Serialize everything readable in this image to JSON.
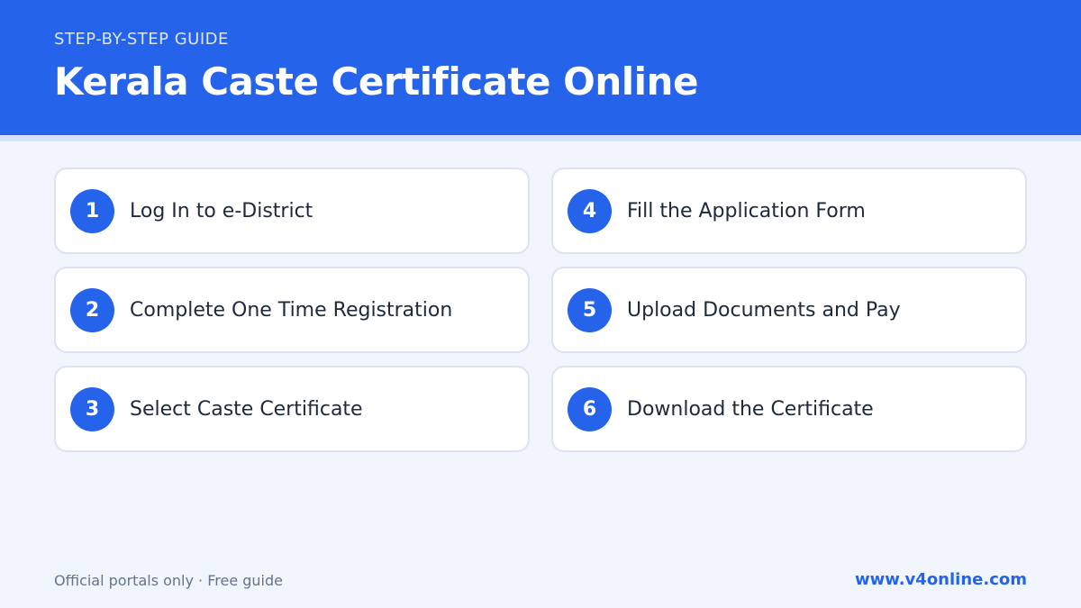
{
  "header": {
    "eyebrow": "STEP-BY-STEP GUIDE",
    "title": "Kerala Caste Certificate Online"
  },
  "steps": [
    {
      "number": "1",
      "label": "Log In to e-District"
    },
    {
      "number": "2",
      "label": "Complete One Time Registration"
    },
    {
      "number": "3",
      "label": "Select Caste Certificate"
    },
    {
      "number": "4",
      "label": "Fill the Application Form"
    },
    {
      "number": "5",
      "label": "Upload Documents and Pay"
    },
    {
      "number": "6",
      "label": "Download the Certificate"
    }
  ],
  "footer": {
    "note": "Official portals only · Free guide",
    "link": "www.v4online.com"
  },
  "colors": {
    "accent": "#2563eb",
    "background": "#f1f5fd"
  }
}
